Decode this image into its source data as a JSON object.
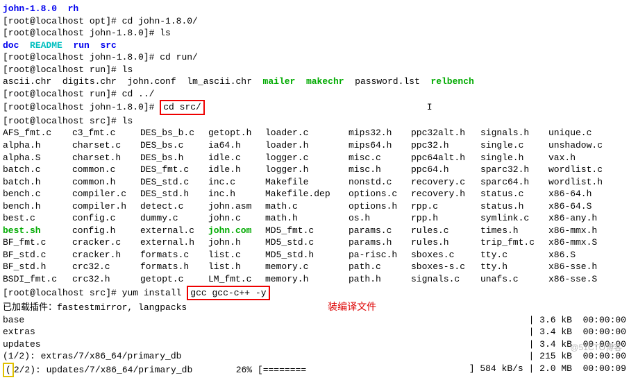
{
  "header_line": {
    "a": "john-1.8.0",
    "b": "rh"
  },
  "prompts": {
    "opt": "[root@localhost opt]#",
    "john": "[root@localhost john-1.8.0]#",
    "run": "[root@localhost run]#",
    "src": "[root@localhost src]#"
  },
  "cmds": {
    "cd_john": "cd john-1.8.0/",
    "ls": "ls",
    "cd_run": "cd run/",
    "cd_up": "cd ../",
    "cd_src": "cd src/",
    "yum": "yum install",
    "yum_args": "gcc gcc-c++ -y"
  },
  "john_ls": {
    "doc": "doc",
    "readme": "README",
    "run": "run",
    "src": "src"
  },
  "run_ls": {
    "a": "ascii.chr",
    "b": "digits.chr",
    "c": "john.conf",
    "d": "lm_ascii.chr",
    "mailer": "mailer",
    "makechr": "makechr",
    "pw": "password.lst",
    "rel": "relbench"
  },
  "src_rows": [
    [
      "AFS_fmt.c",
      "c3_fmt.c",
      "DES_bs_b.c",
      "getopt.h",
      "loader.c",
      "mips32.h",
      "ppc32alt.h",
      "signals.h",
      "unique.c"
    ],
    [
      "alpha.h",
      "charset.c",
      "DES_bs.c",
      "ia64.h",
      "loader.h",
      "mips64.h",
      "ppc32.h",
      "single.c",
      "unshadow.c"
    ],
    [
      "alpha.S",
      "charset.h",
      "DES_bs.h",
      "idle.c",
      "logger.c",
      "misc.c",
      "ppc64alt.h",
      "single.h",
      "vax.h"
    ],
    [
      "batch.c",
      "common.c",
      "DES_fmt.c",
      "idle.h",
      "logger.h",
      "misc.h",
      "ppc64.h",
      "sparc32.h",
      "wordlist.c"
    ],
    [
      "batch.h",
      "common.h",
      "DES_std.c",
      "inc.c",
      "Makefile",
      "nonstd.c",
      "recovery.c",
      "sparc64.h",
      "wordlist.h"
    ],
    [
      "bench.c",
      "compiler.c",
      "DES_std.h",
      "inc.h",
      "Makefile.dep",
      "options.c",
      "recovery.h",
      "status.c",
      "x86-64.h"
    ],
    [
      "bench.h",
      "compiler.h",
      "detect.c",
      "john.asm",
      "math.c",
      "options.h",
      "rpp.c",
      "status.h",
      "x86-64.S"
    ],
    [
      "best.c",
      "config.c",
      "dummy.c",
      "john.c",
      "math.h",
      "os.h",
      "rpp.h",
      "symlink.c",
      "x86-any.h"
    ],
    [
      "best.sh",
      "config.h",
      "external.c",
      "john.com",
      "MD5_fmt.c",
      "params.c",
      "rules.c",
      "times.h",
      "x86-mmx.h"
    ],
    [
      "BF_fmt.c",
      "cracker.c",
      "external.h",
      "john.h",
      "MD5_std.c",
      "params.h",
      "rules.h",
      "trip_fmt.c",
      "x86-mmx.S"
    ],
    [
      "BF_std.c",
      "cracker.h",
      "formats.c",
      "list.c",
      "MD5_std.h",
      "pa-risc.h",
      "sboxes.c",
      "tty.c",
      "x86.S"
    ],
    [
      "BF_std.h",
      "crc32.c",
      "formats.h",
      "list.h",
      "memory.c",
      "path.c",
      "sboxes-s.c",
      "tty.h",
      "x86-sse.h"
    ],
    [
      "BSDI_fmt.c",
      "crc32.h",
      "getopt.c",
      "LM_fmt.c",
      "memory.h",
      "path.h",
      "signals.c",
      "unafs.c",
      "x86-sse.S"
    ]
  ],
  "src_green": {
    "8_0": true,
    "8_3": true
  },
  "note": "装编译文件",
  "yum_out": {
    "plugins": "已加载插件：fastestmirror, langpacks",
    "repos": [
      {
        "name": "base",
        "size": "3.6 kB",
        "time": "00:00:00"
      },
      {
        "name": "extras",
        "size": "3.4 kB",
        "time": "00:00:00"
      },
      {
        "name": "updates",
        "size": "3.4 kB",
        "time": "00:00:00"
      }
    ],
    "l1": {
      "label": "(1/2): extras/7/x86_64/primary_db",
      "size": "215 kB",
      "time": "00:00:00"
    },
    "l2": {
      "label": "(2/2): updates/7/x86_64/primary_db",
      "pct": "26%",
      "bar": "[========",
      "rate": "584 kB/s",
      "size": "2.0 MB",
      "eta": "00:00:09"
    }
  },
  "watermark": "@51CTO博客"
}
